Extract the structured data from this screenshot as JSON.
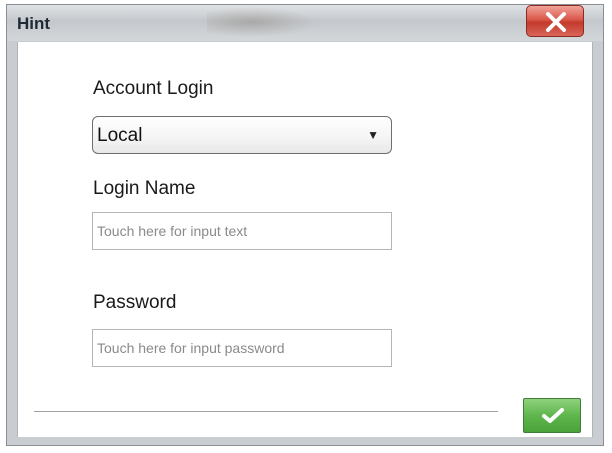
{
  "window": {
    "title": "Hint",
    "close_icon": "close-x-icon"
  },
  "form": {
    "account_login_label": "Account Login",
    "account_login_value": "Local",
    "dropdown_icon": "dropdown-arrow-icon",
    "dropdown_arrow": "▼",
    "login_name_label": "Login Name",
    "login_name_placeholder": "Touch here for input text",
    "login_name_value": "",
    "password_label": "Password",
    "password_placeholder": "Touch here for input password",
    "password_value": ""
  },
  "footer": {
    "confirm_icon": "checkmark-icon"
  },
  "colors": {
    "close_button": "#d9584a",
    "confirm_button": "#5fb64c"
  }
}
